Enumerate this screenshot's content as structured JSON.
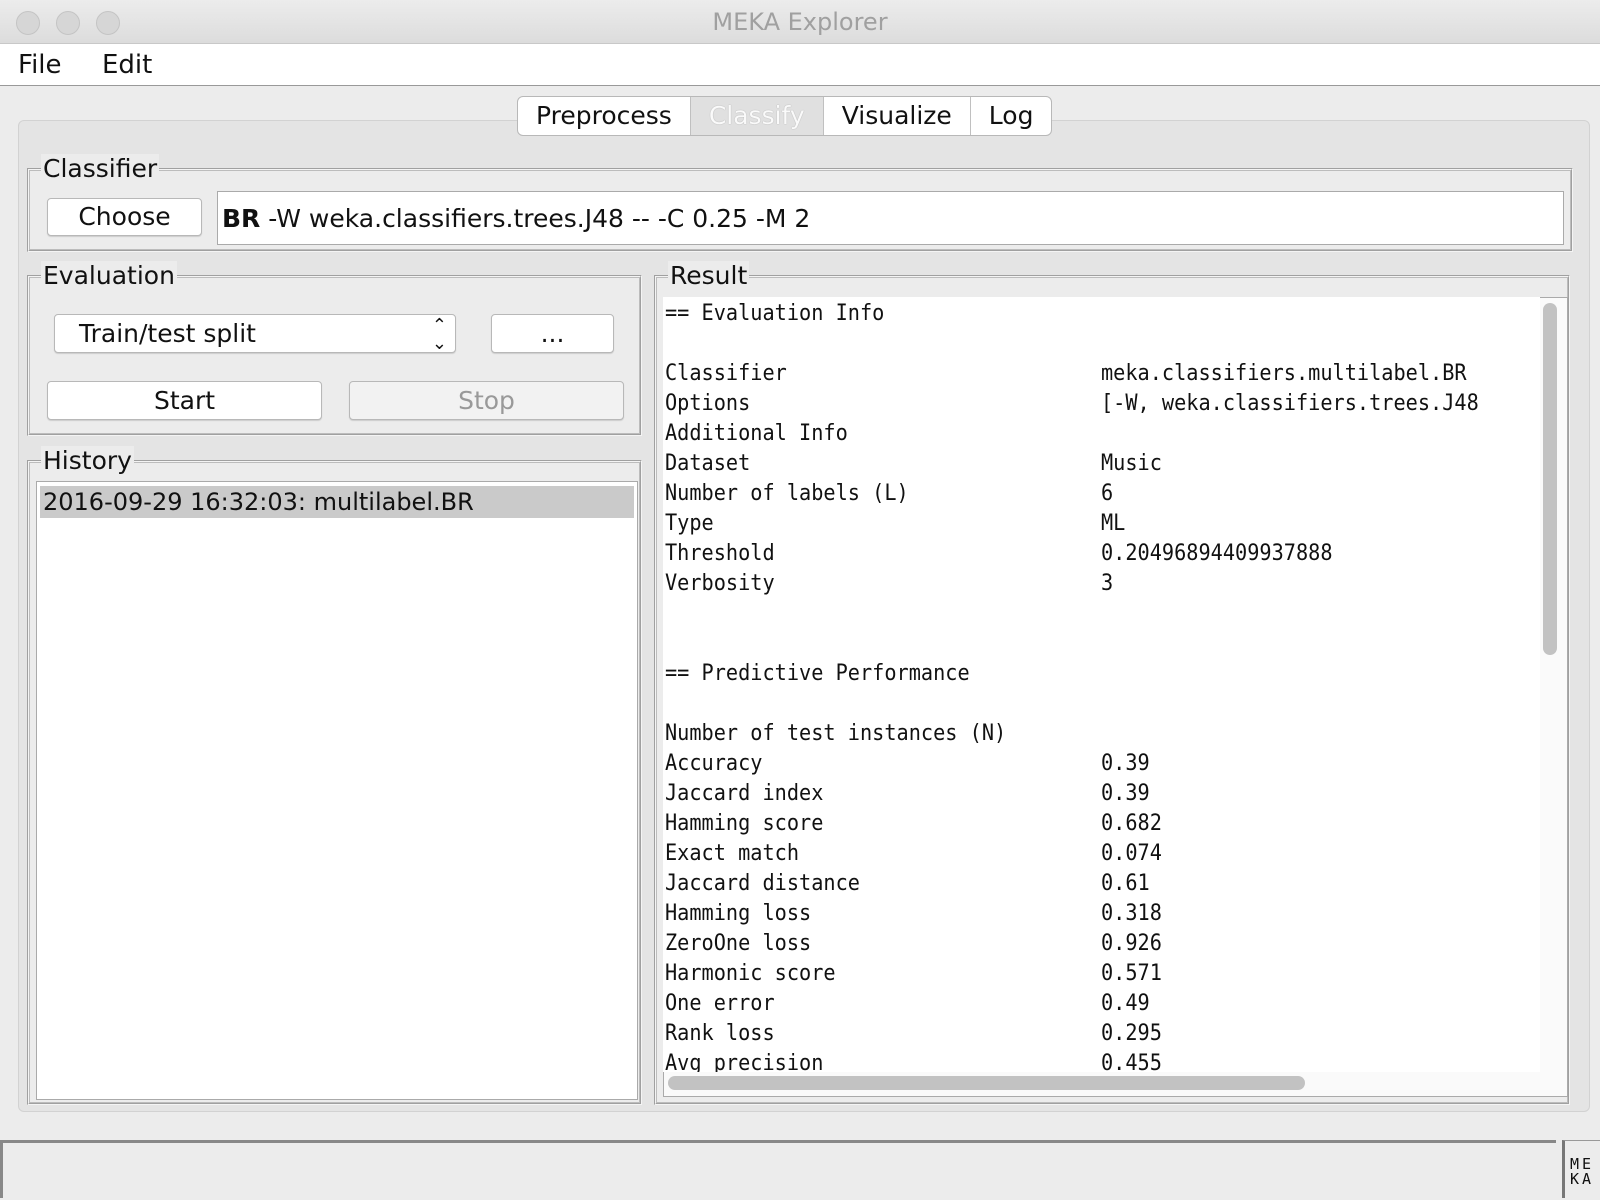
{
  "window": {
    "title": "MEKA Explorer"
  },
  "menu": [
    "File",
    "Edit"
  ],
  "tabs": [
    {
      "label": "Preprocess"
    },
    {
      "label": "Classify",
      "selected": true
    },
    {
      "label": "Visualize"
    },
    {
      "label": "Log"
    }
  ],
  "classifier": {
    "legend": "Classifier",
    "choose_label": "Choose",
    "name": "BR",
    "options": " -W weka.classifiers.trees.J48 -- -C 0.25 -M 2"
  },
  "evaluation": {
    "legend": "Evaluation",
    "method": "Train/test split",
    "options_label": "...",
    "start_label": "Start",
    "stop_label": "Stop"
  },
  "history": {
    "legend": "History",
    "items": [
      "2016-09-29 16:32:03: multilabel.BR"
    ]
  },
  "result": {
    "legend": "Result",
    "lines": [
      [
        "== Evaluation Info",
        ""
      ],
      [
        "",
        ""
      ],
      [
        "Classifier",
        "meka.classifiers.multilabel.BR"
      ],
      [
        "Options",
        "[-W, weka.classifiers.trees.J48"
      ],
      [
        "Additional Info",
        ""
      ],
      [
        "Dataset",
        "Music"
      ],
      [
        "Number of labels (L)",
        "6"
      ],
      [
        "Type",
        "ML"
      ],
      [
        "Threshold",
        "0.20496894409937888"
      ],
      [
        "Verbosity",
        "3"
      ],
      [
        "",
        ""
      ],
      [
        "",
        ""
      ],
      [
        "== Predictive Performance",
        ""
      ],
      [
        "",
        ""
      ],
      [
        "Number of test instances (N)",
        ""
      ],
      [
        "Accuracy",
        "0.39"
      ],
      [
        "Jaccard index",
        "0.39"
      ],
      [
        "Hamming score",
        "0.682"
      ],
      [
        "Exact match",
        "0.074"
      ],
      [
        "Jaccard distance",
        "0.61"
      ],
      [
        "Hamming loss",
        "0.318"
      ],
      [
        "ZeroOne loss",
        "0.926"
      ],
      [
        "Harmonic score",
        "0.571"
      ],
      [
        "One error",
        "0.49"
      ],
      [
        "Rank loss",
        "0.295"
      ],
      [
        "Avg precision",
        "0.455"
      ]
    ]
  },
  "status": {
    "text": "",
    "logo": "MEKA"
  }
}
